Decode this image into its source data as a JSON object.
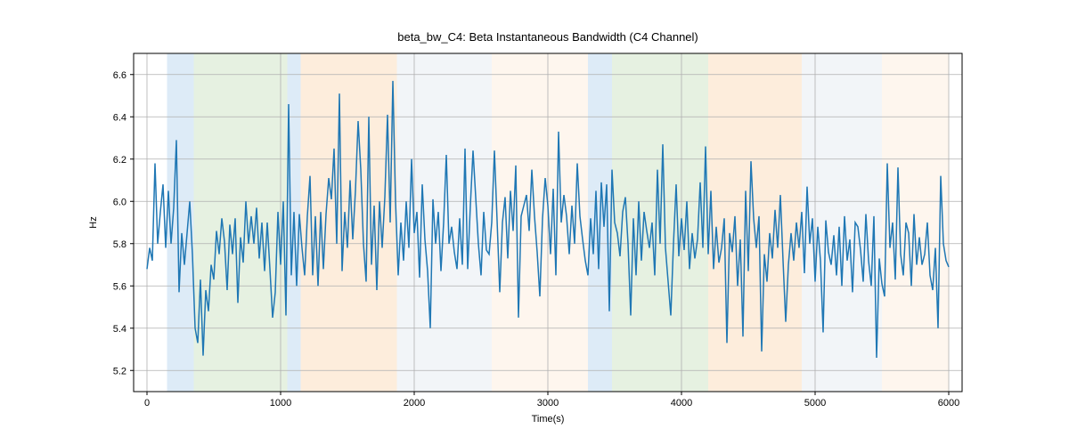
{
  "chart_data": {
    "type": "line",
    "title": "beta_bw_C4: Beta Instantaneous Bandwidth (C4 Channel)",
    "xlabel": "Time(s)",
    "ylabel": "Hz",
    "xlim": [
      -100,
      6100
    ],
    "ylim": [
      5.1,
      6.7
    ],
    "xticks": [
      0,
      1000,
      2000,
      3000,
      4000,
      5000,
      6000
    ],
    "yticks": [
      5.2,
      5.4,
      5.6,
      5.8,
      6.0,
      6.2,
      6.4,
      6.6
    ],
    "bands": [
      {
        "start": 150,
        "end": 350,
        "color": "#9fc5e8"
      },
      {
        "start": 350,
        "end": 1050,
        "color": "#b6d7a8"
      },
      {
        "start": 1050,
        "end": 1150,
        "color": "#9fc5e8"
      },
      {
        "start": 1150,
        "end": 1870,
        "color": "#f9cb9c"
      },
      {
        "start": 1870,
        "end": 2580,
        "color": "#d9e2ec"
      },
      {
        "start": 2580,
        "end": 3300,
        "color": "#fce5cd"
      },
      {
        "start": 3300,
        "end": 3480,
        "color": "#9fc5e8"
      },
      {
        "start": 3480,
        "end": 4200,
        "color": "#b6d7a8"
      },
      {
        "start": 4200,
        "end": 4900,
        "color": "#f9cb9c"
      },
      {
        "start": 4900,
        "end": 5500,
        "color": "#d9e2ec"
      },
      {
        "start": 5500,
        "end": 6000,
        "color": "#fce5cd"
      }
    ],
    "x": [
      0,
      20,
      40,
      60,
      80,
      100,
      120,
      140,
      160,
      180,
      200,
      220,
      240,
      260,
      280,
      300,
      320,
      340,
      360,
      380,
      400,
      420,
      440,
      460,
      480,
      500,
      520,
      540,
      560,
      580,
      600,
      620,
      640,
      660,
      680,
      700,
      720,
      740,
      760,
      780,
      800,
      820,
      840,
      860,
      880,
      900,
      920,
      940,
      960,
      980,
      1000,
      1020,
      1040,
      1060,
      1080,
      1100,
      1120,
      1140,
      1160,
      1180,
      1200,
      1220,
      1240,
      1260,
      1280,
      1300,
      1320,
      1340,
      1360,
      1380,
      1400,
      1420,
      1440,
      1460,
      1480,
      1500,
      1520,
      1540,
      1560,
      1580,
      1600,
      1620,
      1640,
      1660,
      1680,
      1700,
      1720,
      1740,
      1760,
      1780,
      1800,
      1820,
      1840,
      1860,
      1880,
      1900,
      1920,
      1940,
      1960,
      1980,
      2000,
      2020,
      2040,
      2060,
      2080,
      2100,
      2120,
      2140,
      2160,
      2180,
      2200,
      2220,
      2240,
      2260,
      2280,
      2300,
      2320,
      2340,
      2360,
      2380,
      2400,
      2420,
      2440,
      2460,
      2480,
      2500,
      2520,
      2540,
      2560,
      2580,
      2600,
      2620,
      2640,
      2660,
      2680,
      2700,
      2720,
      2740,
      2760,
      2780,
      2800,
      2820,
      2840,
      2860,
      2880,
      2900,
      2920,
      2940,
      2960,
      2980,
      3000,
      3020,
      3040,
      3060,
      3080,
      3100,
      3120,
      3140,
      3160,
      3180,
      3200,
      3220,
      3240,
      3260,
      3280,
      3300,
      3320,
      3340,
      3360,
      3380,
      3400,
      3420,
      3440,
      3460,
      3480,
      3500,
      3520,
      3540,
      3560,
      3580,
      3600,
      3620,
      3640,
      3660,
      3680,
      3700,
      3720,
      3740,
      3760,
      3780,
      3800,
      3820,
      3840,
      3860,
      3880,
      3900,
      3920,
      3940,
      3960,
      3980,
      4000,
      4020,
      4040,
      4060,
      4080,
      4100,
      4120,
      4140,
      4160,
      4180,
      4200,
      4220,
      4240,
      4260,
      4280,
      4300,
      4320,
      4340,
      4360,
      4380,
      4400,
      4420,
      4440,
      4460,
      4480,
      4500,
      4520,
      4540,
      4560,
      4580,
      4600,
      4620,
      4640,
      4660,
      4680,
      4700,
      4720,
      4740,
      4760,
      4780,
      4800,
      4820,
      4840,
      4860,
      4880,
      4900,
      4920,
      4940,
      4960,
      4980,
      5000,
      5020,
      5040,
      5060,
      5080,
      5100,
      5120,
      5140,
      5160,
      5180,
      5200,
      5220,
      5240,
      5260,
      5280,
      5300,
      5320,
      5340,
      5360,
      5380,
      5400,
      5420,
      5440,
      5460,
      5480,
      5500,
      5520,
      5540,
      5560,
      5580,
      5600,
      5620,
      5640,
      5660,
      5680,
      5700,
      5720,
      5740,
      5760,
      5780,
      5800,
      5820,
      5840,
      5860,
      5880,
      5900,
      5920,
      5940,
      5960,
      5980,
      6000
    ],
    "values": [
      5.68,
      5.78,
      5.72,
      6.18,
      5.8,
      5.95,
      6.08,
      5.78,
      6.05,
      5.8,
      5.97,
      6.29,
      5.57,
      5.85,
      5.7,
      5.85,
      6.0,
      5.75,
      5.4,
      5.33,
      5.63,
      5.27,
      5.58,
      5.48,
      5.7,
      5.63,
      5.86,
      5.75,
      5.92,
      5.81,
      5.58,
      5.89,
      5.75,
      5.92,
      5.52,
      5.83,
      5.71,
      6.0,
      5.8,
      5.93,
      5.8,
      5.97,
      5.73,
      5.9,
      5.67,
      5.9,
      5.68,
      5.45,
      5.57,
      5.95,
      5.7,
      6.0,
      5.46,
      6.46,
      5.65,
      5.95,
      5.6,
      5.94,
      5.78,
      5.65,
      5.93,
      6.12,
      5.65,
      5.93,
      5.6,
      5.95,
      5.68,
      5.94,
      6.11,
      6.01,
      6.25,
      5.8,
      6.51,
      5.67,
      5.95,
      5.78,
      6.1,
      5.82,
      6.05,
      6.38,
      6.15,
      5.8,
      5.62,
      6.4,
      5.7,
      5.98,
      5.58,
      6.0,
      5.78,
      6.02,
      6.41,
      5.9,
      6.57,
      6.0,
      5.65,
      5.9,
      5.72,
      6.0,
      5.78,
      6.2,
      5.85,
      5.95,
      5.64,
      6.08,
      5.82,
      5.67,
      5.4,
      6.01,
      5.8,
      5.95,
      5.67,
      5.9,
      6.22,
      5.8,
      5.88,
      5.76,
      5.68,
      5.92,
      5.7,
      6.25,
      5.68,
      5.98,
      6.24,
      6.02,
      5.8,
      5.65,
      5.95,
      5.77,
      5.75,
      5.9,
      6.24,
      5.91,
      5.57,
      5.9,
      6.02,
      5.73,
      6.05,
      5.86,
      6.17,
      5.45,
      5.93,
      5.98,
      6.03,
      5.86,
      6.15,
      5.93,
      5.76,
      5.55,
      5.92,
      6.11,
      5.98,
      5.75,
      6.06,
      5.65,
      6.33,
      5.9,
      6.03,
      5.93,
      5.75,
      5.98,
      5.8,
      6.18,
      5.93,
      5.82,
      5.72,
      5.65,
      5.92,
      5.75,
      6.05,
      5.68,
      6.09,
      5.88,
      6.08,
      5.48,
      6.15,
      5.9,
      5.85,
      5.74,
      5.95,
      6.02,
      5.8,
      5.46,
      5.92,
      5.65,
      6.0,
      5.72,
      5.95,
      5.86,
      5.78,
      5.9,
      5.65,
      6.15,
      5.8,
      6.27,
      5.78,
      5.62,
      5.46,
      5.8,
      6.08,
      5.74,
      5.92,
      5.77,
      6.0,
      5.68,
      5.85,
      5.73,
      5.82,
      6.09,
      5.78,
      6.26,
      5.75,
      6.05,
      5.68,
      5.88,
      5.71,
      5.78,
      5.92,
      5.33,
      5.85,
      5.76,
      5.93,
      5.6,
      5.82,
      5.36,
      6.05,
      5.67,
      6.19,
      5.92,
      5.78,
      5.93,
      5.29,
      5.75,
      5.62,
      5.85,
      5.73,
      5.96,
      5.78,
      6.03,
      5.72,
      5.43,
      5.7,
      5.85,
      5.72,
      5.9,
      5.78,
      5.95,
      5.66,
      6.07,
      5.8,
      5.92,
      5.62,
      5.88,
      5.72,
      5.38,
      5.91,
      5.76,
      5.7,
      5.84,
      5.65,
      5.88,
      5.6,
      5.93,
      5.72,
      5.82,
      5.57,
      5.9,
      5.88,
      5.77,
      5.62,
      5.94,
      5.72,
      5.6,
      5.93,
      5.26,
      5.73,
      5.61,
      5.55,
      6.18,
      5.78,
      5.9,
      5.63,
      6.16,
      5.75,
      5.65,
      5.9,
      5.85,
      5.6,
      5.94,
      5.7,
      5.83,
      5.7,
      5.75,
      5.9,
      5.65,
      5.58,
      5.78,
      5.4,
      6.12,
      5.8,
      5.72,
      5.69
    ]
  }
}
